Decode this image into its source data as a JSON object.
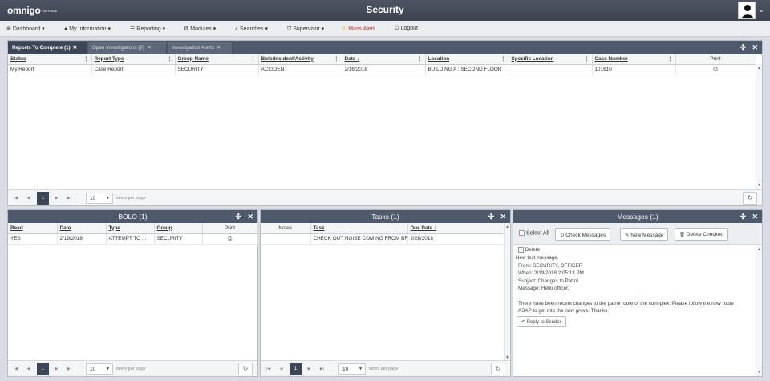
{
  "app": {
    "logo": "omnigo",
    "logo_sub": "SOFTWARE",
    "title": "Security"
  },
  "menu": [
    {
      "label": "Dashboard",
      "icon": "dashboard-icon",
      "glyph": "⊕",
      "caret": "▾"
    },
    {
      "label": "My Information",
      "icon": "user-icon",
      "glyph": "●",
      "caret": "▾"
    },
    {
      "label": "Reporting",
      "icon": "list-icon",
      "glyph": "☰",
      "caret": "▾"
    },
    {
      "label": "Modules",
      "icon": "modules-icon",
      "glyph": "⚙",
      "caret": "▾"
    },
    {
      "label": "Searches",
      "icon": "search-icon",
      "glyph": "⌕",
      "caret": "▾"
    },
    {
      "label": "Supervisor",
      "icon": "shield-icon",
      "glyph": "⛉",
      "caret": "▾"
    },
    {
      "label": "Mass Alert",
      "icon": "warning-icon",
      "glyph": "⚠",
      "caret": ""
    },
    {
      "label": "Logout",
      "icon": "power-icon",
      "glyph": "⏻",
      "caret": ""
    }
  ],
  "reports": {
    "tabs": [
      {
        "label": "Reports To Complete (1)"
      },
      {
        "label": "Open Investigations (0)"
      },
      {
        "label": "Investigation Alerts"
      }
    ],
    "columns": [
      "Status",
      "Report Type",
      "Group Name",
      "Bolo/Incident/Activity",
      "Date",
      "Location",
      "Specific Location",
      "Case Number",
      "Print"
    ],
    "rows": [
      [
        "My Report",
        "Case Report",
        "SECURITY",
        "ACCIDENT",
        "2/16/2018",
        "BUILDING A : SECOND FLOOR",
        "",
        "101610"
      ]
    ],
    "page": "1",
    "page_size": "10",
    "items_per_page": "items per page"
  },
  "bolo": {
    "title": "BOLO (1)",
    "columns": [
      "Read",
      "Date",
      "Type",
      "Group",
      "Print"
    ],
    "rows": [
      [
        "YES",
        "2/19/2018",
        "ATTEMPT TO ...",
        "SECURITY"
      ]
    ],
    "page": "1",
    "page_size": "10",
    "items_per_page": "items per page"
  },
  "tasks": {
    "title": "Tasks (1)",
    "columns": [
      "Notes",
      "Task",
      "Due Date"
    ],
    "rows": [
      [
        "",
        "CHECK OUT NOISE COMING FROM BF",
        "2/28/2018"
      ]
    ],
    "page": "1",
    "page_size": "10",
    "items_per_page": "items per page"
  },
  "messages": {
    "title": "Messages (1)",
    "select_all": "Select All",
    "check_messages": "Check Messages",
    "new_message": "New Message",
    "delete_checked": "Delete Checked",
    "delete_label": "Delete",
    "heading": "New text message.",
    "from": "From: SECURITY, OFFICER",
    "when": "When: 2/19/2018 2:05:13 PM",
    "subject": "Subject: Changes to Patrol",
    "message": "Message: Hello officer,",
    "body1": "There have been recent changes to the patrol route of the com-plex. Please follow the new route",
    "body2": "ASAP to get into the new grove. Thanks",
    "reply": "Reply to Sender"
  },
  "glyphs": {
    "move": "✣",
    "close": "✕",
    "kebab": "⋮",
    "sort_down": "↓",
    "print": "⎙",
    "refresh": "↻",
    "first": "|◀",
    "prev": "◀",
    "next": "▶",
    "last": "▶|",
    "caret": "▼",
    "chev_down": "⌄",
    "up": "▲",
    "down": "▼",
    "refresh_sm": "↻",
    "edit": "✎",
    "trash": "🗑",
    "reply": "↶"
  }
}
